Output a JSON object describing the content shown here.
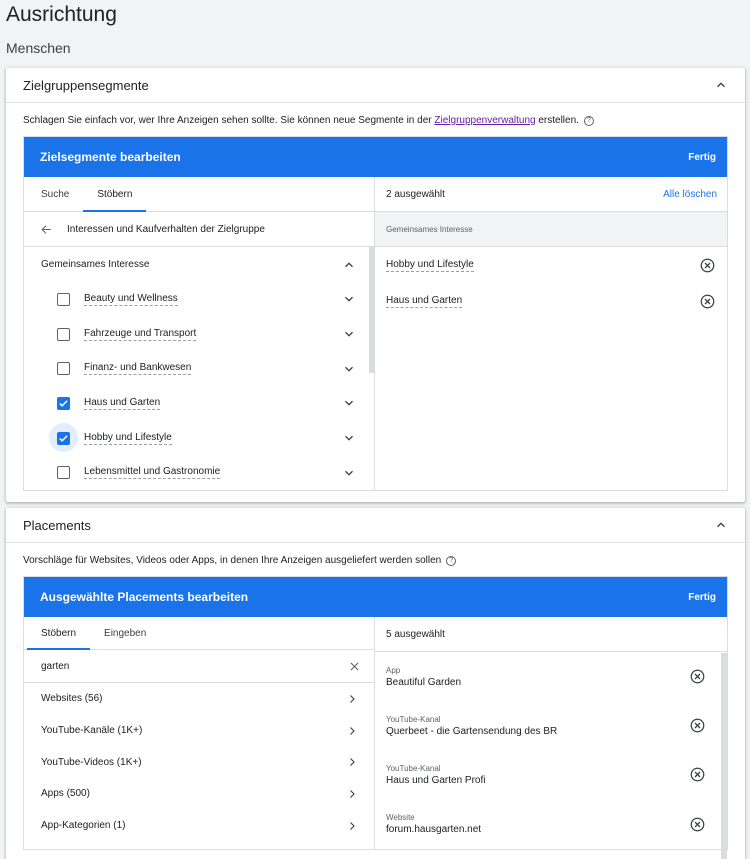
{
  "page": {
    "title": "Ausrichtung",
    "subtitle": "Menschen"
  },
  "segments": {
    "title": "Zielgruppensegmente",
    "desc_prefix": "Schlagen Sie einfach vor, wer Ihre Anzeigen sehen sollte.  Sie können neue Segmente in der ",
    "desc_link": "Zielgruppenverwaltung",
    "desc_suffix": " erstellen.",
    "editor_title": "Zielsegmente bearbeiten",
    "done_label": "Fertig",
    "tabs": [
      "Suche",
      "Stöbern"
    ],
    "back_label": "Interessen und Kaufverhalten der Zielgruppe",
    "category": "Gemeinsames Interesse",
    "items": [
      {
        "label": "Beauty und Wellness",
        "checked": false
      },
      {
        "label": "Fahrzeuge und Transport",
        "checked": false
      },
      {
        "label": "Finanz- und Bankwesen",
        "checked": false
      },
      {
        "label": "Haus und Garten",
        "checked": true
      },
      {
        "label": "Hobby und Lifestyle",
        "checked": true
      },
      {
        "label": "Lebensmittel und Gastronomie",
        "checked": false
      }
    ],
    "selected_count": "2 ausgewählt",
    "clear_all": "Alle löschen",
    "selected_group": "Gemeinsames Interesse",
    "selected": [
      "Hobby und Lifestyle",
      "Haus und Garten"
    ]
  },
  "placements": {
    "title": "Placements",
    "desc": "Vorschläge für Websites, Videos oder Apps, in denen Ihre Anzeigen ausgeliefert werden sollen",
    "editor_title": "Ausgewählte Placements bearbeiten",
    "done_label": "Fertig",
    "tabs": [
      "Stöbern",
      "Eingeben"
    ],
    "search_value": "garten",
    "nav": [
      "Websites (56)",
      "YouTube-Kanäle (1K+)",
      "YouTube-Videos (1K+)",
      "Apps (500)",
      "App-Kategorien (1)"
    ],
    "selected_count": "5 ausgewählt",
    "selected": [
      {
        "type": "App",
        "name": "Beautiful Garden"
      },
      {
        "type": "YouTube-Kanal",
        "name": "Querbeet - die Gartensendung des BR"
      },
      {
        "type": "YouTube-Kanal",
        "name": "Haus und Garten Profi"
      },
      {
        "type": "Website",
        "name": "forum.hausgarten.net"
      }
    ]
  }
}
